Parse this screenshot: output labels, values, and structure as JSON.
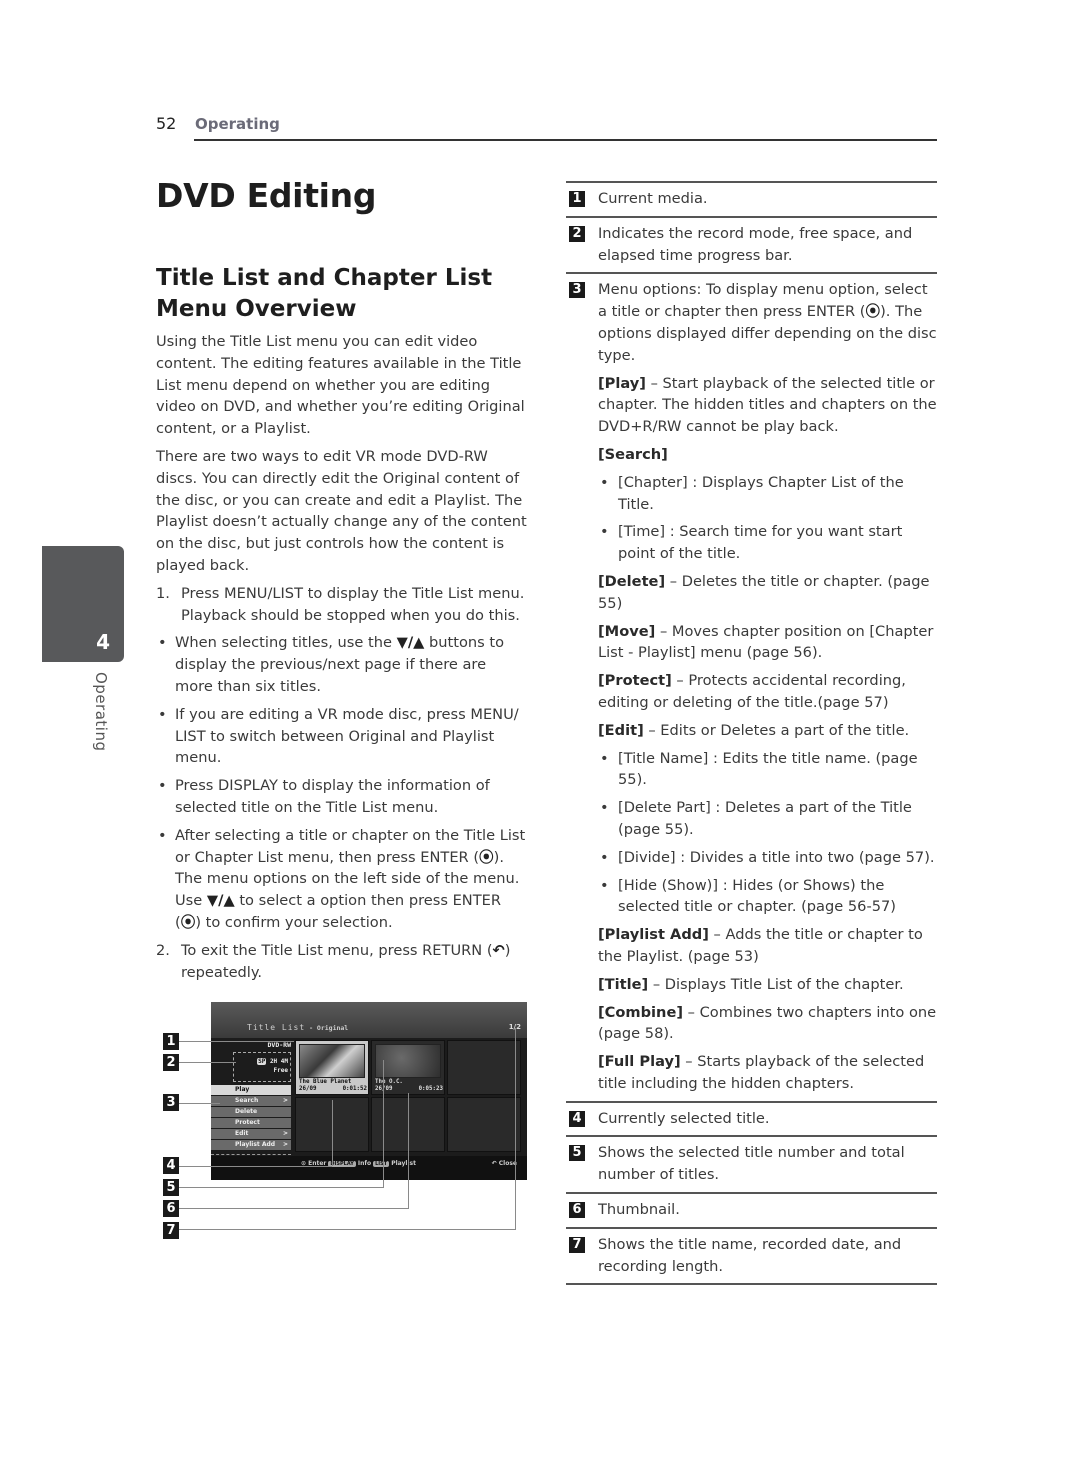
{
  "header": {
    "page_number": "52",
    "section": "Operating"
  },
  "side_tab": {
    "chapter_number": "4",
    "chapter_label": "Operating"
  },
  "title": "DVD Editing",
  "subtitle": "Title List and Chapter List Menu Overview",
  "intro": [
    "Using the Title List menu you can edit video content. The editing features available in the Title List menu depend on whether you are editing video on DVD, and whether you’re editing Original content, or a Playlist.",
    "There are two ways to edit VR mode DVD-RW discs. You can directly edit the Original content of the disc, or you can create and edit a Playlist. The Playlist doesn’t actually change any of the content on the disc, but just controls how the content is played back."
  ],
  "steps": {
    "step1_num": "1.",
    "step1": "Press MENU/LIST to display the Title List menu. Playback should be stopped when you do this.",
    "bullets": {
      "b1_pre": "When selecting titles, use the ",
      "b1_glyph": "▼/▲",
      "b1_post": " buttons to display the previous/next page if there are more than six titles.",
      "b2": "If you are editing a VR mode disc, press MENU/ LIST to switch between Original and Playlist menu.",
      "b3": "Press DISPLAY to display the information of selected title on the Title List menu.",
      "b4_a": "After selecting a title or chapter on the Title List or Chapter List menu, then press ENTER (",
      "b4_enter": "⦿",
      "b4_b": "). The menu options on the left side of the menu. Use ",
      "b4_glyph": "▼/▲",
      "b4_c": " to select a option then press ENTER (",
      "b4_d": ") to confirm your selection."
    },
    "step2_num": "2.",
    "step2_a": "To exit the Title List menu, press RETURN (",
    "step2_icon": "↶",
    "step2_b": ") repeatedly."
  },
  "diagram": {
    "screen_title": "Title List",
    "screen_mode": " - Original",
    "page_indicator": "1/2",
    "media": "DVD-RW",
    "record_mode": "SP",
    "free_time": "2H 4M",
    "free_label": "Free",
    "menu_options": [
      {
        "label": "Play",
        "arrow": ""
      },
      {
        "label": "Search",
        "arrow": ">"
      },
      {
        "label": "Delete",
        "arrow": ""
      },
      {
        "label": "Protect",
        "arrow": ""
      },
      {
        "label": "Edit",
        "arrow": ">"
      },
      {
        "label": "Playlist Add",
        "arrow": ">"
      }
    ],
    "titles": [
      {
        "name": "The Blue Planet",
        "date": "26/09",
        "length": "0:01:52"
      },
      {
        "name": "The O.C.",
        "date": "26/09",
        "length": "0:05:23"
      }
    ],
    "footer": {
      "enter": "⊙ Enter",
      "display_key": "DISPLAY",
      "info": "Info",
      "list_key": "LIST",
      "playlist": "Playlist",
      "close": "↶ Close"
    },
    "callouts": [
      "1",
      "2",
      "3",
      "4",
      "5",
      "6",
      "7"
    ]
  },
  "legend": {
    "item1": {
      "num": "1",
      "text": "Current media."
    },
    "item2": {
      "num": "2",
      "text": "Indicates the record mode, free space, and elapsed time progress bar."
    },
    "item3": {
      "num": "3",
      "text_a": "Menu options: To display menu option, select a title or chapter then press ENTER (",
      "enter": "⦿",
      "text_b": "). The options displayed differ depending on the disc type.",
      "play_label": "[Play]",
      "play_text": " – Start playback of the selected title or chapter. The hidden titles and chapters on the DVD+R/RW cannot be play back.",
      "search_label": "[Search]",
      "search_bullets": [
        "[Chapter] : Displays Chapter List of the Title.",
        "[Time] : Search time for you want start point of the title."
      ],
      "delete_label": "[Delete]",
      "delete_text": " – Deletes the title or chapter. (page 55)",
      "move_label": "[Move]",
      "move_text": " – Moves chapter position on [Chapter List - Playlist] menu (page 56).",
      "protect_label": "[Protect]",
      "protect_text": " – Protects accidental recording, editing or deleting of the title.(page 57)",
      "edit_label": "[Edit]",
      "edit_text": " – Edits or Deletes a part of the title.",
      "edit_bullets": [
        "[Title Name] : Edits the title name. (page 55).",
        "[Delete Part] : Deletes a part of the Title (page 55).",
        "[Divide] : Divides a title into two (page 57).",
        "[Hide (Show)] : Hides (or Shows) the selected title or  chapter. (page 56-57)"
      ],
      "playlist_add_label": "[Playlist Add]",
      "playlist_add_text": " – Adds the title or chapter to the Playlist. (page 53)",
      "title_label": "[Title]",
      "title_text": " – Displays Title List of the chapter.",
      "combine_label": "[Combine]",
      "combine_text": " – Combines two chapters into one (page 58).",
      "full_play_label": "[Full Play]",
      "full_play_text": " – Starts playback of the selected title including the hidden chapters."
    },
    "item4": {
      "num": "4",
      "text": "Currently selected title."
    },
    "item5": {
      "num": "5",
      "text": "Shows the selected title number and total number of titles."
    },
    "item6": {
      "num": "6",
      "text": "Thumbnail."
    },
    "item7": {
      "num": "7",
      "text": "Shows the title name, recorded date, and recording length."
    }
  }
}
